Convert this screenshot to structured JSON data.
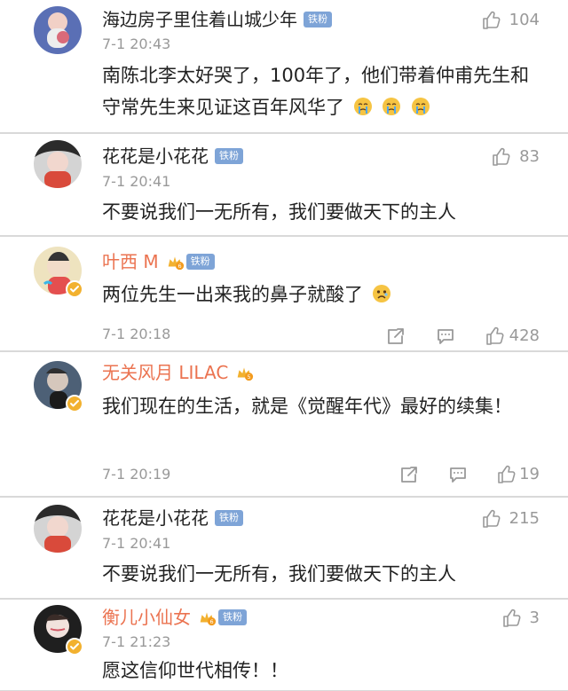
{
  "comments": [
    {
      "username": "海边房子里住着山城少年",
      "badge": "铁粉",
      "timestamp": "7-1 20:43",
      "text": "南陈北李太好哭了，100年了，他们带着仲甫先生和守常先生来见证这百年风华了",
      "emoji_icons": [
        "crying-emoji-icon",
        "crying-emoji-icon",
        "crying-emoji-icon"
      ],
      "likes": "104"
    },
    {
      "username": "花花是小花花",
      "badge": "铁粉",
      "timestamp": "7-1 20:41",
      "text": "不要说我们一无所有，我们要做天下的主人",
      "likes": "83"
    },
    {
      "username": "叶西 M",
      "badge": "铁粉",
      "badge_level": "6",
      "timestamp": "7-1 20:18",
      "text": "两位先生一出来我的鼻子就酸了",
      "emoji_icons": [
        "sad-emoji-icon"
      ],
      "likes": "428",
      "has_verified_badge": true
    },
    {
      "username": "无关风月 LILAC",
      "badge_level": "5",
      "timestamp": "7-1 20:19",
      "text": "我们现在的生活，就是《觉醒年代》最好的续集！",
      "likes": "19",
      "has_verified_badge": true
    },
    {
      "username": "花花是小花花",
      "badge": "铁粉",
      "timestamp": "7-1 20:41",
      "text": "不要说我们一无所有，我们要做天下的主人",
      "likes": "215"
    },
    {
      "username": "衡儿小仙女",
      "badge": "铁粉",
      "badge_level": "6",
      "timestamp": "7-1 21:23",
      "text": "愿这信仰世代相传！！",
      "likes": "3",
      "has_verified_badge": true
    }
  ],
  "colors": {
    "page_background": "#e9e9e9",
    "card_background": "#ffffff",
    "text": "#222222",
    "muted_text": "#999999",
    "vip_name": "#eb7350",
    "fan_badge": "#7ea4d7",
    "crown": "#f2b12f",
    "verified": "#f2b12f"
  },
  "icons": {
    "like": "thumbs-up-icon",
    "share": "share-icon",
    "comment": "comment-icon",
    "verified": "verified-badge-icon",
    "crown": "crown-badge-icon"
  }
}
